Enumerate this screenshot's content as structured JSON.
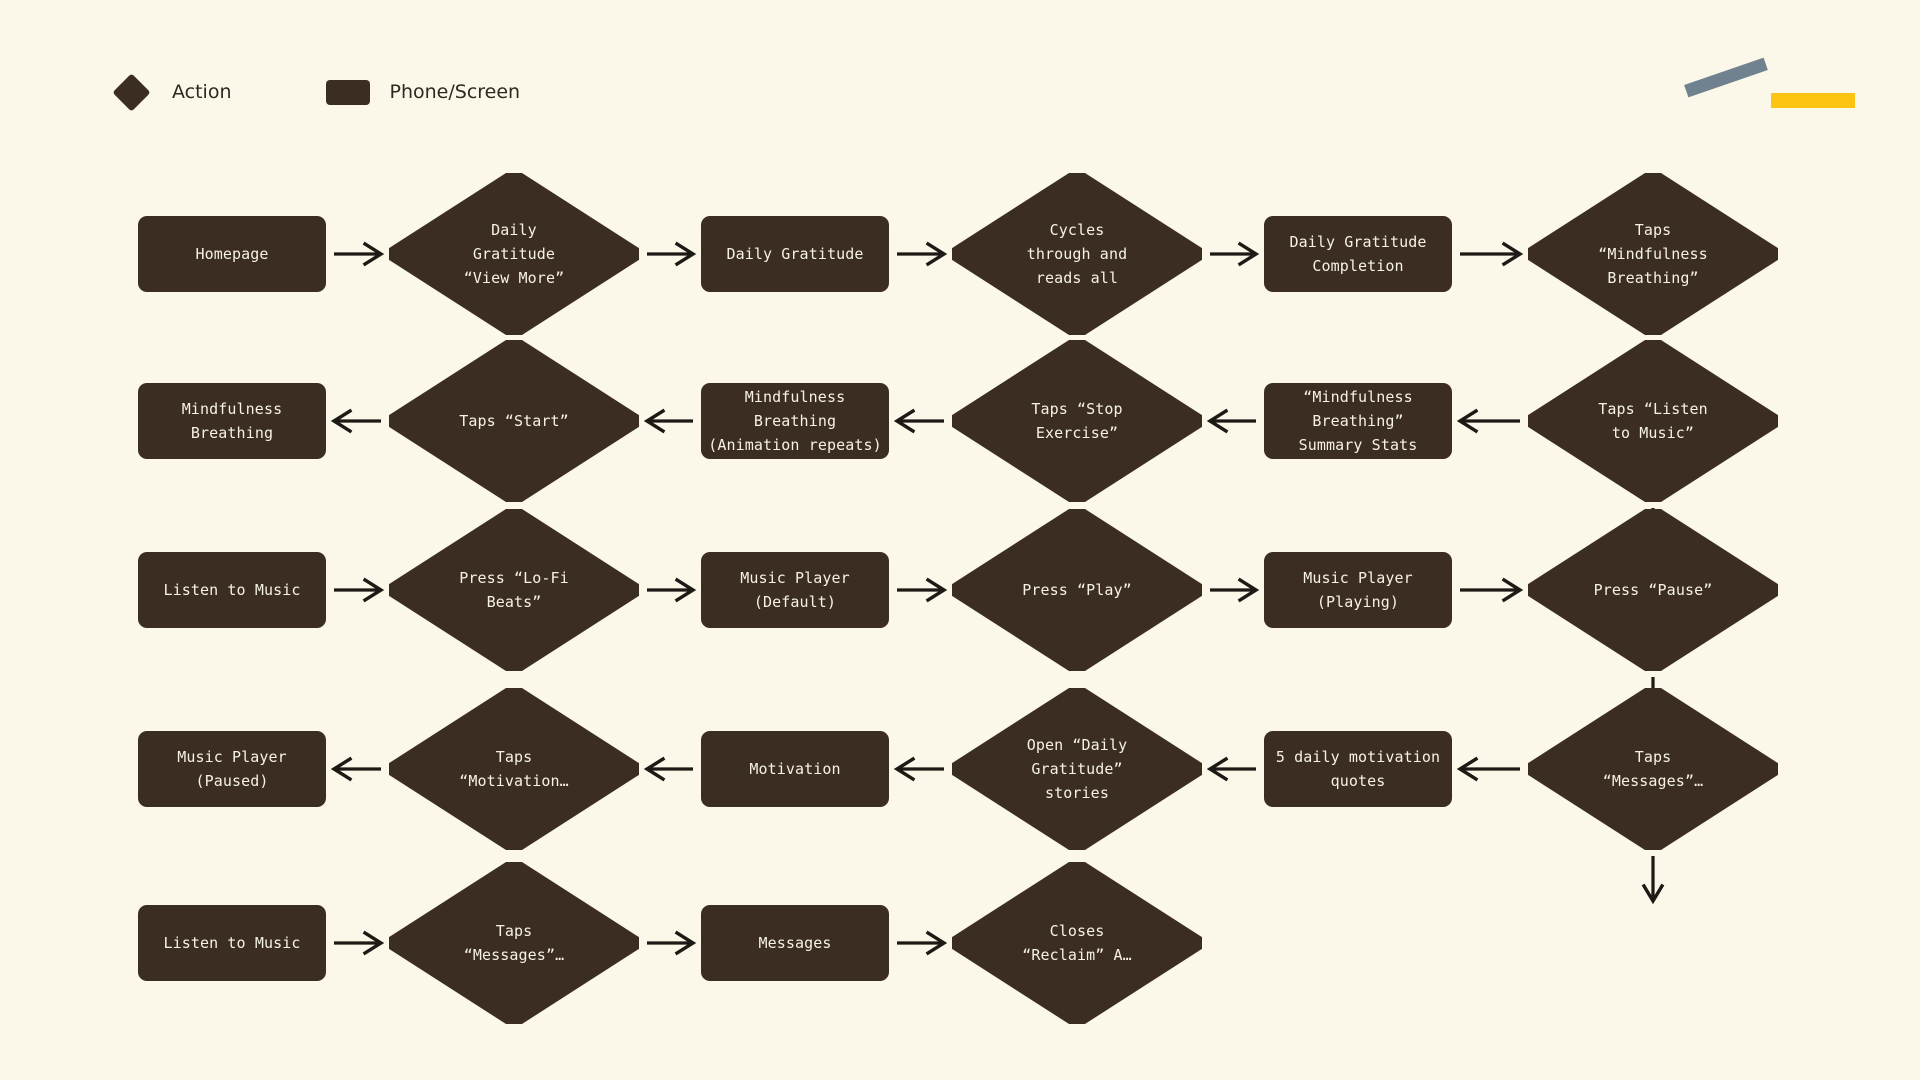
{
  "theme": {
    "background": "#fbf8e9",
    "node_fill": "#3b2d22",
    "node_text": "#f6f2e4",
    "edge_color": "#1d1a16",
    "legend_text": "#2e2820",
    "deco_slate": "#708290",
    "deco_gold": "#fec413"
  },
  "legend": {
    "action_label": "Action",
    "screen_label": "Phone/Screen"
  },
  "flow": {
    "rows": [
      {
        "direction": "right",
        "nodes": [
          {
            "id": "n1",
            "type": "screen",
            "label": "Homepage"
          },
          {
            "id": "n2",
            "type": "action",
            "label": "Daily\nGratitude\n“View More”"
          },
          {
            "id": "n3",
            "type": "screen",
            "label": "Daily Gratitude"
          },
          {
            "id": "n4",
            "type": "action",
            "label": "Cycles\nthrough and\nreads all"
          },
          {
            "id": "n5",
            "type": "screen",
            "label": "Daily Gratitude\nCompletion"
          },
          {
            "id": "n6",
            "type": "action",
            "label": "Taps\n“Mindfulness\nBreathing”"
          }
        ]
      },
      {
        "direction": "left",
        "nodes": [
          {
            "id": "n7",
            "type": "action",
            "label": "Taps “Listen\nto Music”"
          },
          {
            "id": "n8",
            "type": "screen",
            "label": "“Mindfulness\nBreathing”\nSummary Stats"
          },
          {
            "id": "n9",
            "type": "action",
            "label": "Taps “Stop\nExercise”"
          },
          {
            "id": "n10",
            "type": "screen",
            "label": "Mindfulness Breathing\n(Animation repeats)"
          },
          {
            "id": "n11",
            "type": "action",
            "label": "Taps “Start”"
          },
          {
            "id": "n12",
            "type": "screen",
            "label": "Mindfulness Breathing"
          }
        ]
      },
      {
        "direction": "right",
        "nodes": [
          {
            "id": "n13",
            "type": "screen",
            "label": "Listen to Music"
          },
          {
            "id": "n14",
            "type": "action",
            "label": "Press “Lo-Fi\nBeats”"
          },
          {
            "id": "n15",
            "type": "screen",
            "label": "Music Player\n(Default)"
          },
          {
            "id": "n16",
            "type": "action",
            "label": "Press “Play”"
          },
          {
            "id": "n17",
            "type": "screen",
            "label": "Music Player\n(Playing)"
          },
          {
            "id": "n18",
            "type": "action",
            "label": "Press “Pause”"
          }
        ]
      },
      {
        "direction": "left",
        "nodes": [
          {
            "id": "n19",
            "type": "action",
            "label": "Taps\n“Messages”…"
          },
          {
            "id": "n20",
            "type": "screen",
            "label": "5 daily motivation\nquotes"
          },
          {
            "id": "n21",
            "type": "action",
            "label": "Open “Daily\nGratitude”\nstories"
          },
          {
            "id": "n22",
            "type": "screen",
            "label": "Motivation"
          },
          {
            "id": "n23",
            "type": "action",
            "label": "Taps\n“Motivation…"
          },
          {
            "id": "n24",
            "type": "screen",
            "label": "Music Player\n(Paused)"
          }
        ]
      },
      {
        "direction": "right",
        "nodes": [
          {
            "id": "n25",
            "type": "screen",
            "label": "Listen to Music"
          },
          {
            "id": "n26",
            "type": "action",
            "label": "Taps\n“Messages”…"
          },
          {
            "id": "n27",
            "type": "screen",
            "label": "Messages"
          },
          {
            "id": "n28",
            "type": "action",
            "label": "Closes\n“Reclaim” A…"
          }
        ]
      }
    ]
  }
}
